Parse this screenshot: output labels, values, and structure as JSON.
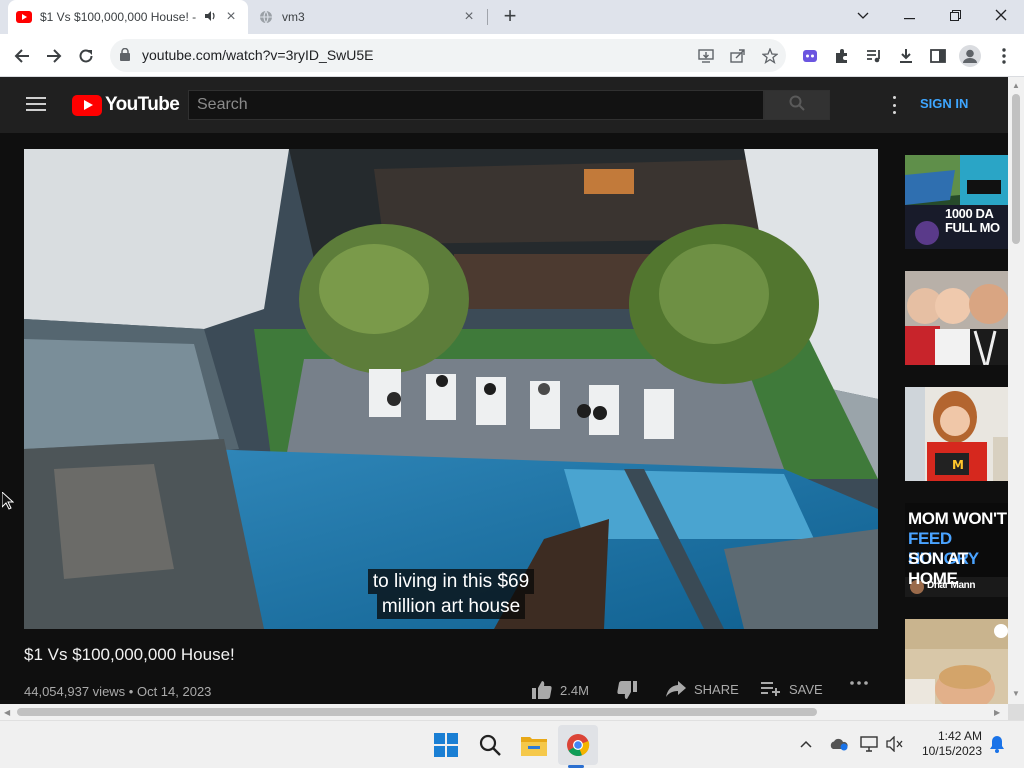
{
  "browser": {
    "tabs": [
      {
        "title": "$1 Vs $100,000,000 House! -",
        "active": true,
        "playing_audio": true,
        "favicon": "youtube-favicon"
      },
      {
        "title": "vm3",
        "active": false,
        "favicon": "globe-icon"
      }
    ],
    "url": "youtube.com/watch?v=3ryID_SwU5E",
    "window_controls": [
      "chevron-down-icon",
      "minimize-icon",
      "restore-icon",
      "close-icon"
    ]
  },
  "youtube": {
    "logo_text": "YouTube",
    "search_placeholder": "Search",
    "sign_in": "SIGN IN",
    "caption_line1": "to living in this $69",
    "caption_line2": "million art house",
    "video_title": "$1 Vs $100,000,000 House!",
    "views": "44,054,937 views",
    "date": "Oct 14, 2023",
    "meta_separator": " • ",
    "likes": "2.4M",
    "share_label": "SHARE",
    "save_label": "SAVE",
    "recommended": [
      {
        "overlay_line1": "1000 DA",
        "overlay_line2": "FULL MO",
        "accent": "#3a7fd0"
      },
      {
        "overlay_line1": "",
        "overlay_line2": "",
        "accent": "#c8242b"
      },
      {
        "overlay_line1": "",
        "overlay_line2": "",
        "accent": "#d6281e"
      },
      {
        "overlay_line1": "MOM WON'T",
        "overlay_line2": "FEED HUNGRY",
        "overlay_line3": "SON AT HOME",
        "channel": "Dhar Mann",
        "accent": "#1f6fd8"
      },
      {
        "overlay_line1": "",
        "overlay_line2": "",
        "accent": "#d8c7a8"
      }
    ]
  },
  "taskbar": {
    "apps": [
      "windows-start-icon",
      "search-icon",
      "file-explorer-icon",
      "chrome-icon"
    ],
    "time": "1:42 AM",
    "date": "10/15/2023"
  },
  "colors": {
    "youtube_red": "#ff0000",
    "signin_blue": "#3ea6ff",
    "page_bg": "#0f0f0f"
  }
}
